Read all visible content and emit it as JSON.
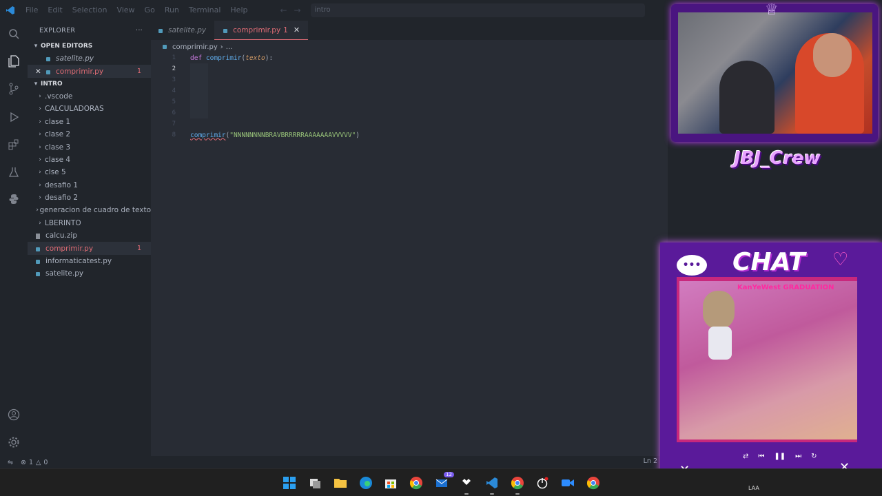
{
  "menu": [
    "File",
    "Edit",
    "Selection",
    "View",
    "Go",
    "Run",
    "Terminal",
    "Help"
  ],
  "command_center": "intro",
  "explorer": {
    "title": "EXPLORER",
    "open_editors_label": "OPEN EDITORS",
    "open_editors": [
      {
        "name": "satelite.py",
        "modified": false,
        "errors": ""
      },
      {
        "name": "comprimir.py",
        "modified": true,
        "errors": "1"
      }
    ],
    "folder_label": "INTRO",
    "folders": [
      ".vscode",
      "CALCULADORAS",
      "clase 1",
      "clase 2",
      "clase 3",
      "clase 4",
      "clse 5",
      "desafio 1",
      "desafio 2",
      "generacion de cuadro de texto",
      "LBERINTO"
    ],
    "files": [
      {
        "name": "calcu.zip",
        "errors": ""
      },
      {
        "name": "comprimir.py",
        "errors": "1"
      },
      {
        "name": "informaticatest.py",
        "errors": ""
      },
      {
        "name": "satelite.py",
        "errors": ""
      }
    ]
  },
  "tabs": [
    {
      "label": "satelite.py",
      "badge": ""
    },
    {
      "label": "comprimir.py",
      "badge": "1"
    }
  ],
  "breadcrumb": {
    "file": "comprimir.py",
    "rest": "..."
  },
  "code": {
    "line_numbers": [
      "1",
      "2",
      "3",
      "4",
      "5",
      "6",
      "7",
      "8"
    ],
    "l1_kw": "def",
    "l1_fn": "comprimir",
    "l1_open": "(",
    "l1_param": "texto",
    "l1_close": "):",
    "l8_fn": "comprimir",
    "l8_open": "(",
    "l8_str": "\"NNNNNNNNBRAVBRRRRRAAAAAAAVVVVV\"",
    "l8_close": ")"
  },
  "status": {
    "errors": "1",
    "warnings": "0",
    "right": "Ln 2"
  },
  "taskbar": {
    "badge_count": "12",
    "language": "LAA"
  },
  "overlay": {
    "crew_text": "JBJ_Crew",
    "chat_text": "CHAT",
    "album_title": "KanYeWest GRADUATION"
  },
  "colors": {
    "accent_error": "#e06c75",
    "background_editor": "#282c34",
    "background_sidebar": "#21252b",
    "overlay_purple": "#5a1a9a"
  }
}
